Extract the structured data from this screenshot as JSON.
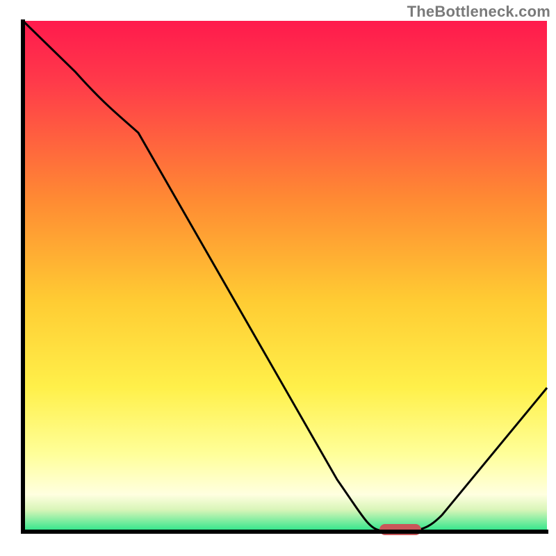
{
  "attribution": "TheBottleneck.com",
  "colors": {
    "gradient_top": "#ff1a4d",
    "gradient_mid1": "#ff7a33",
    "gradient_mid2": "#ffd633",
    "gradient_mid3": "#ffff66",
    "gradient_mid4": "#ffffcc",
    "gradient_bottom": "#33e68c",
    "axis": "#000000",
    "curve": "#000000",
    "marker": "#c9575a"
  },
  "chart_data": {
    "type": "line",
    "title": "",
    "xlabel": "",
    "ylabel": "",
    "xlim": [
      0,
      100
    ],
    "ylim": [
      0,
      100
    ],
    "x": [
      0,
      10,
      22,
      60,
      68,
      75,
      80,
      100
    ],
    "values": [
      100,
      90,
      78,
      10,
      0,
      0,
      3,
      28
    ],
    "marker": {
      "x_start": 68,
      "x_end": 76,
      "y": 0
    },
    "grid": false,
    "legend": false,
    "notes": "Background is a vertical bottleneck gradient (red→green). Curve shows mismatch % vs position; minimum zone marked by red pill near x≈72."
  }
}
